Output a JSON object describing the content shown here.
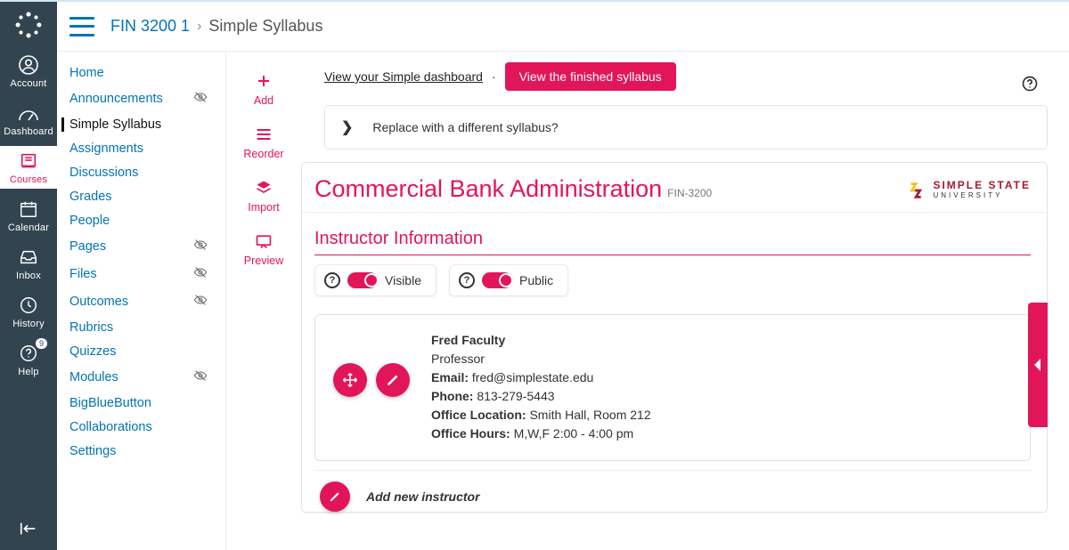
{
  "globalnav": {
    "items": [
      {
        "label": "Account"
      },
      {
        "label": "Dashboard"
      },
      {
        "label": "Courses"
      },
      {
        "label": "Calendar"
      },
      {
        "label": "Inbox"
      },
      {
        "label": "History"
      },
      {
        "label": "Help"
      }
    ],
    "help_badge": "9"
  },
  "breadcrumb": {
    "course": "FIN 3200 1",
    "sep": "›",
    "page": "Simple Syllabus"
  },
  "coursemenu": [
    {
      "label": "Home"
    },
    {
      "label": "Announcements",
      "hidden": true
    },
    {
      "label": "Simple Syllabus",
      "active": true
    },
    {
      "label": "Assignments"
    },
    {
      "label": "Discussions"
    },
    {
      "label": "Grades"
    },
    {
      "label": "People"
    },
    {
      "label": "Pages",
      "hidden": true
    },
    {
      "label": "Files",
      "hidden": true
    },
    {
      "label": "Outcomes",
      "hidden": true
    },
    {
      "label": "Rubrics"
    },
    {
      "label": "Quizzes"
    },
    {
      "label": "Modules",
      "hidden": true
    },
    {
      "label": "BigBlueButton"
    },
    {
      "label": "Collaborations"
    },
    {
      "label": "Settings"
    }
  ],
  "toolcol": {
    "add": "Add",
    "reorder": "Reorder",
    "import": "Import",
    "preview": "Preview"
  },
  "stage": {
    "dashboard_link": "View your Simple dashboard",
    "dot": "·",
    "finished_btn": "View the finished syllabus",
    "replace_prompt": "Replace with a different syllabus?"
  },
  "syllabus": {
    "title": "Commercial Bank Administration",
    "course_code": "FIN-3200",
    "university_line1": "SIMPLE STATE",
    "university_line2": "UNIVERSITY"
  },
  "section": {
    "title": "Instructor Information",
    "visible_label": "Visible",
    "public_label": "Public"
  },
  "instructor": {
    "name": "Fred Faculty",
    "role": "Professor",
    "email_label": "Email:",
    "email": "fred@simplestate.edu",
    "phone_label": "Phone:",
    "phone": "813-279-5443",
    "loc_label": "Office Location:",
    "loc": "Smith Hall, Room 212",
    "hours_label": "Office Hours:",
    "hours": "M,W,F 2:00 - 4:00 pm"
  },
  "addrow": {
    "label": "Add new instructor"
  }
}
